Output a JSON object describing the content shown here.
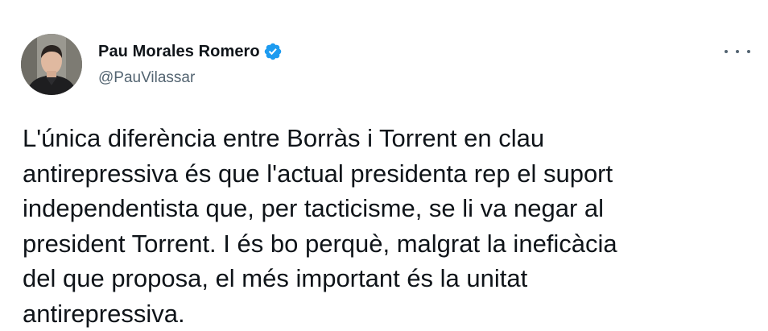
{
  "author": {
    "display_name": "Pau Morales Romero",
    "handle": "@PauVilassar",
    "verified": true,
    "avatar_icon": "profile-photo"
  },
  "menu": {
    "icon": "more-dots-icon"
  },
  "tweet": {
    "text": "L'única diferència entre Borràs i Torrent en clau\nantirepressiva és que l'actual presidenta rep el suport\nindependentista que, per tacticisme, se li va negar al\npresident Torrent. I és bo perquè, malgrat la ineficàcia\ndel que proposa, el més important és la unitat\nantirepressiva."
  },
  "colors": {
    "text": "#0f1419",
    "secondary": "#536471",
    "verified_badge": "#1d9bf0"
  }
}
